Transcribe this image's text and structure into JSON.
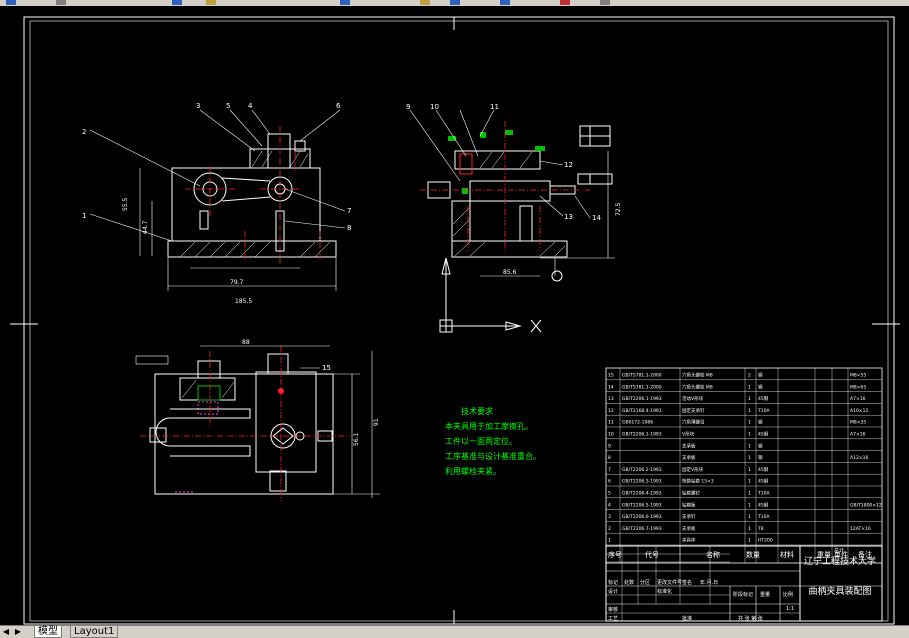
{
  "tabs": {
    "model": "模型",
    "layout1": "Layout1"
  },
  "tech": {
    "title": "技术要求",
    "lines": [
      "本夹具用于加工摩擦孔。",
      "工件以一面两定位。",
      "工序基准与设计基准重合。",
      "利用螺栓夹紧。"
    ]
  },
  "balloons": [
    "1",
    "2",
    "3",
    "4",
    "5",
    "6",
    "7",
    "8",
    "9",
    "10",
    "11",
    "12",
    "13",
    "14",
    "15"
  ],
  "dims": {
    "front_bottom": "185.5",
    "front_inner": "79.7",
    "front_height": "55.5",
    "front_small": "44.7",
    "side_base": "85.6",
    "side_height": "72.5",
    "top_width": "88",
    "top_height": "56.1",
    "top_outer": "91"
  },
  "title_block": {
    "school": "辽宁工程技术大学",
    "drawing": "曲柄夹具装配图",
    "headers": {
      "seq": "序号",
      "code": "代号",
      "name": "名称",
      "qty": "数量",
      "material": "材料",
      "single": "单件",
      "total": "总计",
      "weight": "重量",
      "remark": "备注"
    },
    "rows": [
      {
        "seq": "15",
        "code": "GB/T5781.1-2000",
        "name": "六角头螺栓 M8",
        "qty": "2",
        "material": "钢",
        "remark": "M8×55"
      },
      {
        "seq": "14",
        "code": "GB/T5781.1-2000",
        "name": "六角头螺栓 M8",
        "qty": "1",
        "material": "钢",
        "remark": "M8×65"
      },
      {
        "seq": "13",
        "code": "GB/T2206.1-1993",
        "name": "活动V形块",
        "qty": "1",
        "material": "45钢",
        "remark": "A7×16"
      },
      {
        "seq": "12",
        "code": "GB/T2168.4-1991",
        "name": "固定支承钉",
        "qty": "1",
        "material": "T10A",
        "remark": "A10×12"
      },
      {
        "seq": "11",
        "code": "GB6172-1986",
        "name": "六角薄螺母",
        "qty": "1",
        "material": "钢",
        "remark": "M8×35"
      },
      {
        "seq": "10",
        "code": "GB/T2206.1-1993",
        "name": "V形块",
        "qty": "1",
        "material": "45钢",
        "remark": "A7×16"
      },
      {
        "seq": "9",
        "code": "",
        "name": "支承板",
        "qty": "1",
        "material": "钢",
        "remark": ""
      },
      {
        "seq": "8",
        "code": "",
        "name": "支承板",
        "qty": "1",
        "material": "钢",
        "remark": "A12×16"
      },
      {
        "seq": "7",
        "code": "GB/T2206.2-1993",
        "name": "固定V形块",
        "qty": "1",
        "material": "45钢",
        "remark": ""
      },
      {
        "seq": "6",
        "code": "GB/T2206.3-1993",
        "name": "快换钻套 15×3",
        "qty": "1",
        "material": "45钢",
        "remark": ""
      },
      {
        "seq": "5",
        "code": "GB/T2206.4-1993",
        "name": "钻套螺钉",
        "qty": "1",
        "material": "T10A",
        "remark": ""
      },
      {
        "seq": "4",
        "code": "GB/T2206.5-1993",
        "name": "钻模板",
        "qty": "1",
        "material": "45钢",
        "remark": "GB/T1800×12"
      },
      {
        "seq": "3",
        "code": "GB/T2206.6-1993",
        "name": "支承钉",
        "qty": "1",
        "material": "T10A",
        "remark": ""
      },
      {
        "seq": "2",
        "code": "GB/T2206.7-1993",
        "name": "支承板",
        "qty": "1",
        "material": "T8",
        "remark": "12AT×16"
      },
      {
        "seq": "1",
        "code": "",
        "name": "夹具体",
        "qty": "1",
        "material": "HT200",
        "remark": ""
      }
    ],
    "sign_labels": [
      "标记",
      "处数",
      "分区",
      "更改文件号",
      "签名",
      "年.月.日"
    ],
    "design_labels": [
      "设计",
      "标准化"
    ],
    "stage_labels": [
      "阶段标记",
      "重量",
      "比例"
    ],
    "scale": "1:1",
    "audit": [
      "审核"
    ],
    "process": [
      "工艺"
    ],
    "approve": "批准",
    "sheet": "共 张  第 张"
  }
}
